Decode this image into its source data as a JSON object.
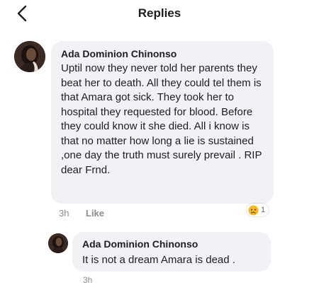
{
  "header": {
    "title": "Replies"
  },
  "comments": [
    {
      "author": "Ada Dominion Chinonso",
      "text": "Uptil now they never told her parents they beat her to death. All they could tel them is that Amara got sick. They took her to hospital they requested for blood. Before they could know it she died. All i know is that no matter how long a lie is sustained ,one day the truth must surely prevail . RIP dear Frnd.",
      "time": "3h",
      "like_label": "Like",
      "reaction": {
        "icon": "sad-face-icon",
        "count": "1"
      }
    },
    {
      "author": "Ada Dominion Chinonso",
      "text": "It is not a dream Amara is dead .",
      "time": "3h"
    }
  ],
  "colors": {
    "bubble": "#f0f2f5",
    "meta_text": "#8a8d91",
    "reaction_face": "#f7b928"
  }
}
